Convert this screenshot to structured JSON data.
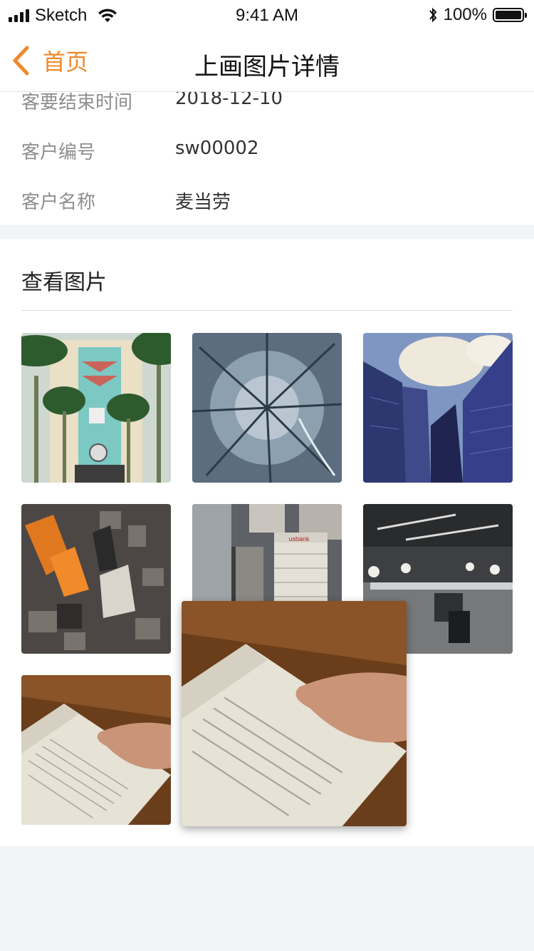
{
  "status_bar": {
    "carrier": "Sketch",
    "time": "9:41 AM",
    "battery": "100%"
  },
  "nav": {
    "back_label": "首页",
    "title": "上画图片详情"
  },
  "info": {
    "partial_label": "客要结束时间",
    "partial_value": "2018-12-10",
    "rows": [
      {
        "label": "客户编号",
        "value": "sw00002"
      },
      {
        "label": "客户名称",
        "value": "麦当劳"
      }
    ]
  },
  "gallery": {
    "title": "查看图片",
    "images": [
      {
        "name": "palm-tree-building-photo"
      },
      {
        "name": "snowy-forest-aerial-photo"
      },
      {
        "name": "glass-skyscrapers-photo"
      },
      {
        "name": "city-aerial-photo"
      },
      {
        "name": "downtown-towers-photo",
        "sign": "usbank"
      },
      {
        "name": "open-office-photo"
      },
      {
        "name": "reading-book-photo"
      }
    ],
    "dragging": {
      "name": "reading-book-photo-dragging"
    }
  },
  "colors": {
    "accent": "#f0892a",
    "background": "#f2f4f6",
    "label_gray": "#8e8e8e"
  }
}
